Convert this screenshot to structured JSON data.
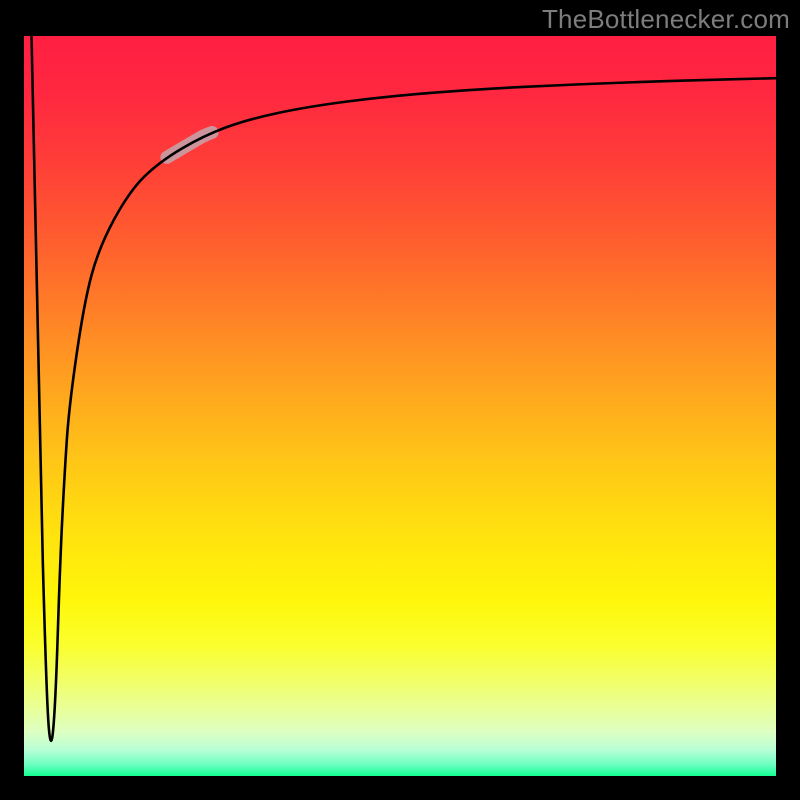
{
  "attribution": "TheBottlenecker.com",
  "chart_data": {
    "type": "line",
    "title": "",
    "xlabel": "",
    "ylabel": "",
    "xlim": [
      0,
      100
    ],
    "ylim": [
      0,
      100
    ],
    "axes_visible": false,
    "background_gradient": {
      "stops": [
        {
          "offset": 0.0,
          "color": "#ff1f42"
        },
        {
          "offset": 0.08,
          "color": "#ff2840"
        },
        {
          "offset": 0.18,
          "color": "#ff4037"
        },
        {
          "offset": 0.28,
          "color": "#ff5f2e"
        },
        {
          "offset": 0.38,
          "color": "#ff8226"
        },
        {
          "offset": 0.48,
          "color": "#ffa61e"
        },
        {
          "offset": 0.58,
          "color": "#ffc816"
        },
        {
          "offset": 0.68,
          "color": "#ffe40e"
        },
        {
          "offset": 0.76,
          "color": "#fff60a"
        },
        {
          "offset": 0.82,
          "color": "#fbff2a"
        },
        {
          "offset": 0.87,
          "color": "#f2ff66"
        },
        {
          "offset": 0.91,
          "color": "#e8ff9a"
        },
        {
          "offset": 0.94,
          "color": "#ddffc2"
        },
        {
          "offset": 0.965,
          "color": "#b8ffd6"
        },
        {
          "offset": 0.985,
          "color": "#6affc0"
        },
        {
          "offset": 1.0,
          "color": "#12ff93"
        }
      ]
    },
    "series": [
      {
        "name": "bottleneck-curve",
        "color": "#000000",
        "stroke_width": 2.6,
        "x": [
          1.0,
          2.0,
          3.0,
          3.6,
          4.2,
          4.8,
          5.4,
          6.0,
          8.0,
          10.0,
          14.0,
          18.0,
          24.0,
          30.0,
          38.0,
          48.0,
          60.0,
          74.0,
          88.0,
          100.0
        ],
        "y": [
          100.0,
          48.0,
          10.0,
          3.0,
          10.0,
          29.0,
          41.0,
          50.0,
          64.0,
          71.5,
          79.0,
          83.0,
          86.6,
          88.8,
          90.5,
          91.8,
          92.8,
          93.5,
          94.0,
          94.3
        ]
      }
    ],
    "marker": {
      "name": "highlight-segment",
      "on_series": "bottleneck-curve",
      "x_range": [
        19.0,
        25.0
      ],
      "color": "#c99aa1",
      "stroke_width": 13
    }
  }
}
